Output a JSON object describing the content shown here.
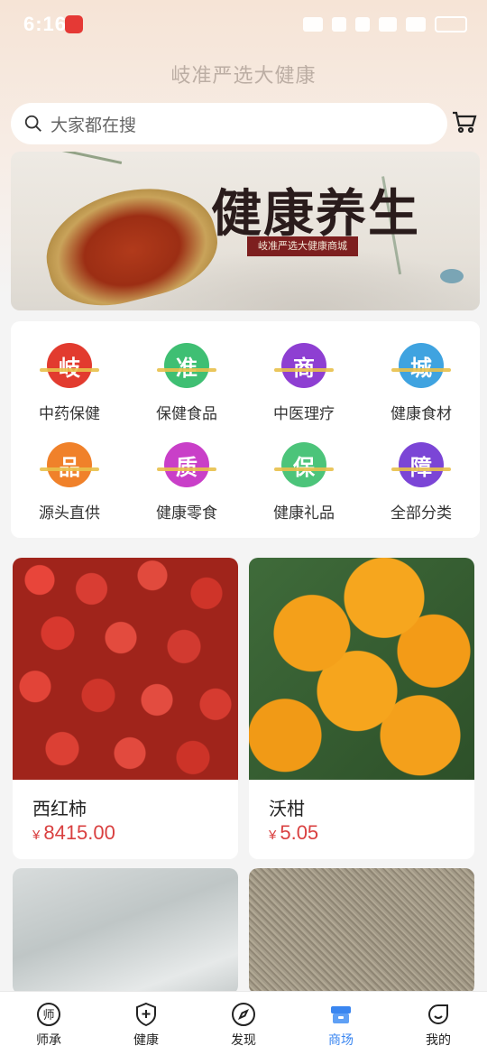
{
  "status_bar": {
    "time": "6:16",
    "battery": ""
  },
  "header": {
    "title": "岐准严选大健康"
  },
  "search": {
    "placeholder": "大家都在搜"
  },
  "banner": {
    "title": "健康养生",
    "subtitle": "岐准严选大健康商城"
  },
  "categories": [
    {
      "glyph": "岐",
      "label": "中药保健",
      "color": "#e23b2f"
    },
    {
      "glyph": "准",
      "label": "保健食品",
      "color": "#3fbf73"
    },
    {
      "glyph": "商",
      "label": "中医理疗",
      "color": "#8e3fd2"
    },
    {
      "glyph": "城",
      "label": "健康食材",
      "color": "#3fa3e0"
    },
    {
      "glyph": "品",
      "label": "源头直供",
      "color": "#f0812a"
    },
    {
      "glyph": "质",
      "label": "健康零食",
      "color": "#c93fc8"
    },
    {
      "glyph": "保",
      "label": "健康礼品",
      "color": "#4cc47a"
    },
    {
      "glyph": "障",
      "label": "全部分类",
      "color": "#7b45d6"
    }
  ],
  "products": [
    {
      "name": "西红柿",
      "price": "8415.00",
      "currency": "¥",
      "image": "cherry-tomatoes"
    },
    {
      "name": "沃柑",
      "price": "5.05",
      "currency": "¥",
      "image": "mandarin-oranges"
    },
    {
      "name": "",
      "price": "",
      "currency": "",
      "image": "small-silver-fish"
    },
    {
      "name": "",
      "price": "",
      "currency": "",
      "image": "grain"
    }
  ],
  "tabs": [
    {
      "label": "师承",
      "icon": "mentor-icon",
      "active": false
    },
    {
      "label": "健康",
      "icon": "shield-plus-icon",
      "active": false
    },
    {
      "label": "发现",
      "icon": "compass-icon",
      "active": false
    },
    {
      "label": "商场",
      "icon": "store-icon",
      "active": true
    },
    {
      "label": "我的",
      "icon": "smile-face-icon",
      "active": false
    }
  ],
  "colors": {
    "accent": "#3a86f0",
    "price": "#d94040"
  }
}
